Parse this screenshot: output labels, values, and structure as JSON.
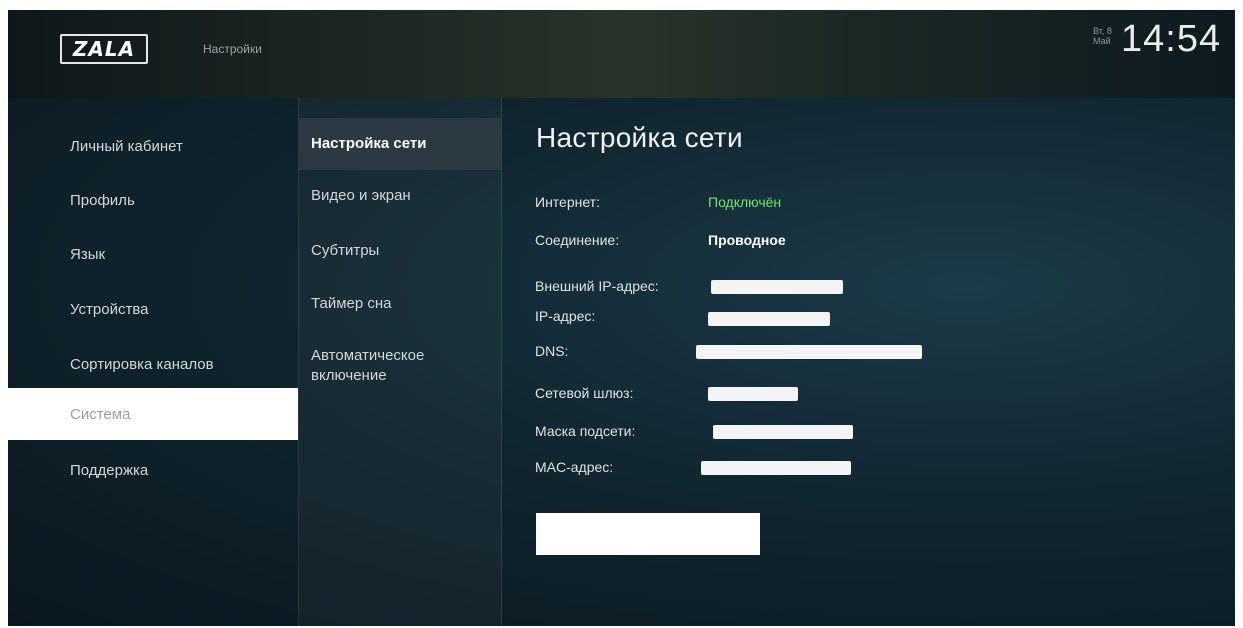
{
  "header": {
    "logo_text": "ZALA",
    "app_title": "Настройки",
    "date_line1": "Вт, 8",
    "date_line2": "Май",
    "time": "14:54"
  },
  "sidebar": {
    "items": [
      {
        "label": "Личный кабинет",
        "active": false
      },
      {
        "label": "Профиль",
        "active": false
      },
      {
        "label": "Язык",
        "active": false
      },
      {
        "label": "Устройства",
        "active": false
      },
      {
        "label": "Сортировка каналов",
        "active": false
      },
      {
        "label": "Система",
        "active": true
      },
      {
        "label": "Поддержка",
        "active": false
      }
    ]
  },
  "submenu": {
    "items": [
      {
        "label": "Настройка сети",
        "active": true
      },
      {
        "label": "Видео и экран",
        "active": false
      },
      {
        "label": "Субтитры",
        "active": false
      },
      {
        "label": "Таймер сна",
        "active": false
      },
      {
        "label": "Автоматическое включение",
        "active": false
      }
    ]
  },
  "panel": {
    "title": "Настройка сети",
    "rows": [
      {
        "label": "Интернет:",
        "value": "Подключён",
        "value_color": "#6ee36a"
      },
      {
        "label": "Соединение:",
        "value": "Проводное"
      },
      {
        "label": "Внешний IP-адрес:",
        "value": ""
      },
      {
        "label": "IP-адрес:",
        "value": ""
      },
      {
        "label": "DNS:",
        "value": ""
      },
      {
        "label": "Сетевой шлюз:",
        "value": ""
      },
      {
        "label": "Маска подсети:",
        "value": ""
      },
      {
        "label": "MAC-адрес:",
        "value": ""
      }
    ],
    "button_label": ""
  },
  "colors": {
    "accent_green": "#6ee36a",
    "background": "#0f2029",
    "selected_item_bg": "#ffffff"
  }
}
